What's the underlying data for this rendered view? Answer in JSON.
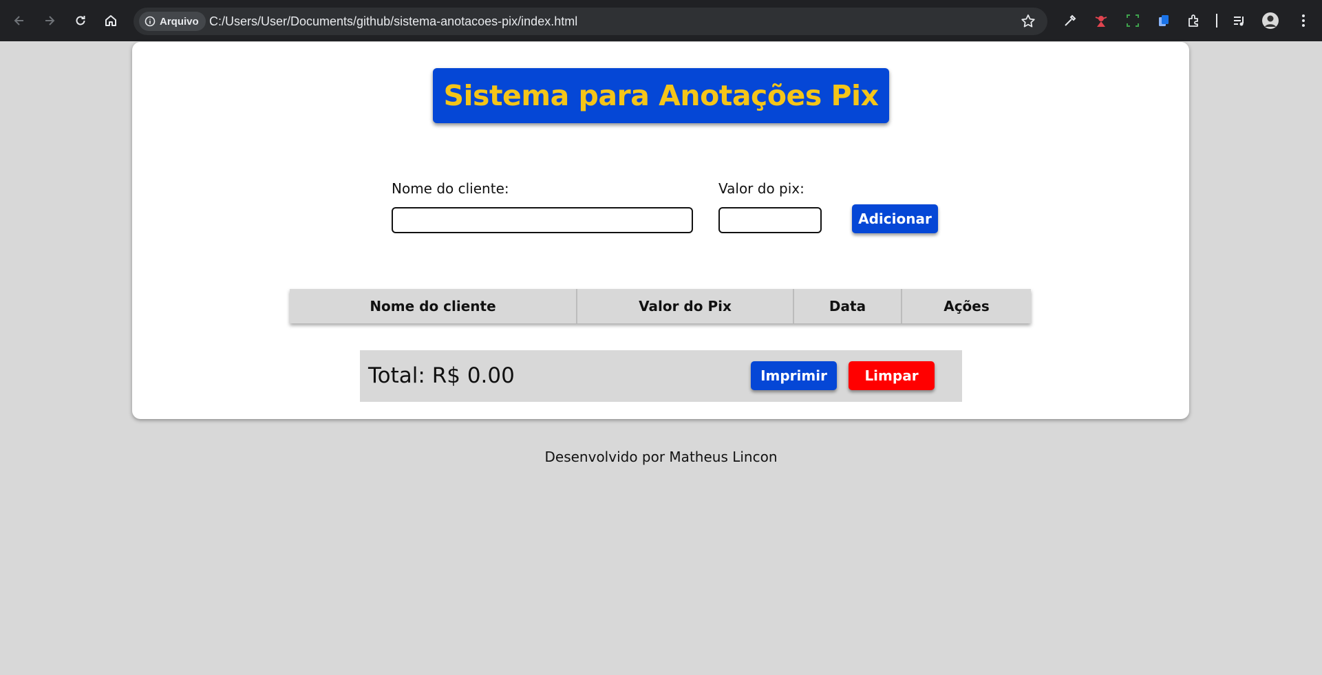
{
  "browser": {
    "security_chip": "Arquivo",
    "url": "C:/Users/User/Documents/github/sistema-anotacoes-pix/index.html"
  },
  "page": {
    "title": "Sistema para Anotações Pix",
    "form": {
      "client_label": "Nome do cliente:",
      "client_value": "",
      "pix_label": "Valor do pix:",
      "pix_value": "",
      "add_button": "Adicionar"
    },
    "table": {
      "headers": [
        "Nome do cliente",
        "Valor do Pix",
        "Data",
        "Ações"
      ],
      "rows": []
    },
    "summary": {
      "total": "Total: R$ 0.00",
      "print_button": "Imprimir",
      "clear_button": "Limpar"
    },
    "footer": "Desenvolvido por Matheus Lincon"
  },
  "colors": {
    "primary_blue": "#0547d6",
    "title_yellow": "#f5c518",
    "danger_red": "#ff0000",
    "background": "#d8d8d8"
  }
}
